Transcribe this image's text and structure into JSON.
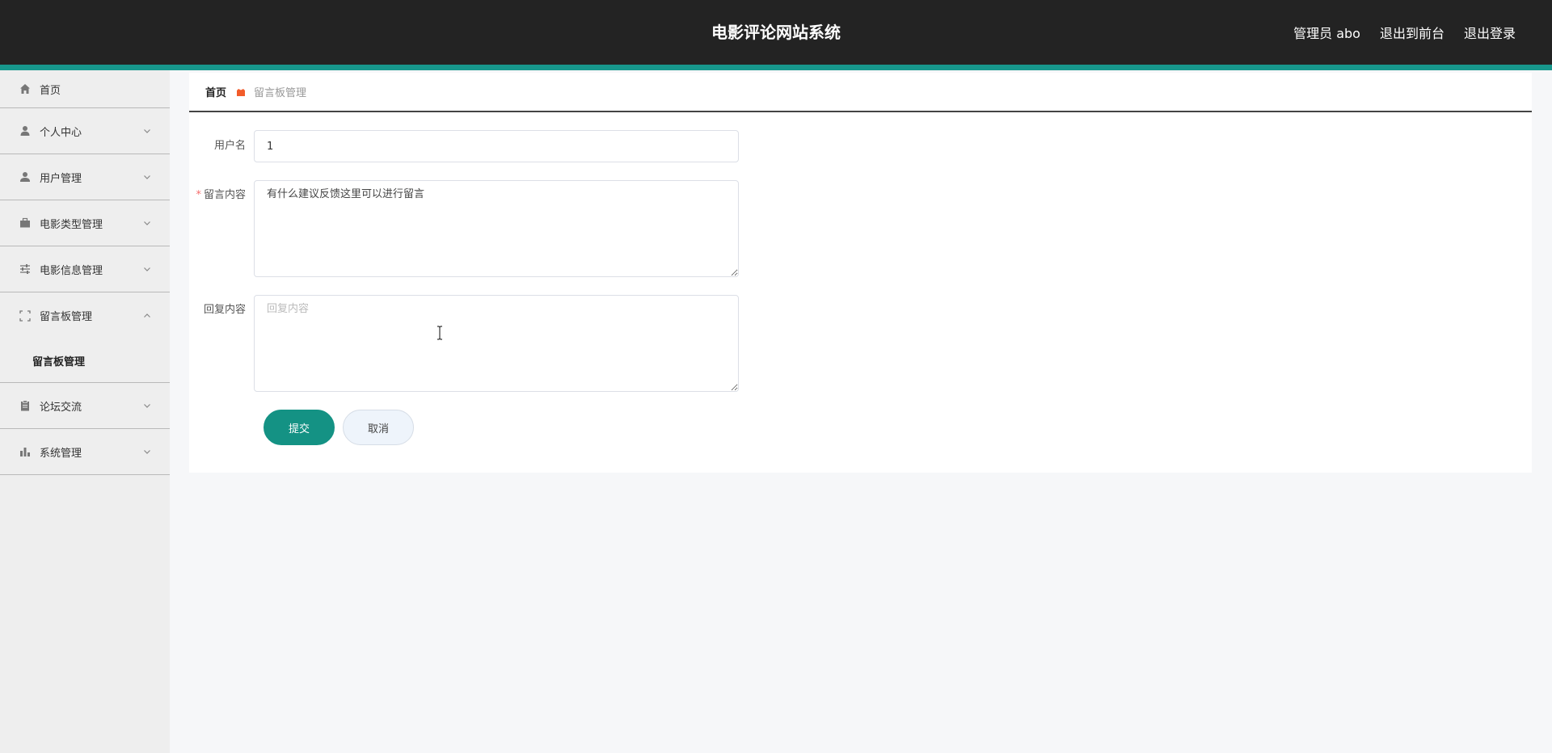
{
  "header": {
    "title": "电影评论网站系统",
    "admin_label": "管理员 abo",
    "to_front_label": "退出到前台",
    "logout_label": "退出登录"
  },
  "sidebar": {
    "items": [
      {
        "label": "首页",
        "icon": "home-icon"
      },
      {
        "label": "个人中心",
        "icon": "user-icon"
      },
      {
        "label": "用户管理",
        "icon": "user-manage-icon"
      },
      {
        "label": "电影类型管理",
        "icon": "briefcase-icon"
      },
      {
        "label": "电影信息管理",
        "icon": "sliders-icon"
      },
      {
        "label": "留言板管理",
        "icon": "frame-icon"
      },
      {
        "label": "论坛交流",
        "icon": "clipboard-icon"
      },
      {
        "label": "系统管理",
        "icon": "bar-chart-icon"
      }
    ],
    "submenu": {
      "label": "留言板管理"
    }
  },
  "breadcrumb": {
    "home": "首页",
    "current": "留言板管理"
  },
  "form": {
    "username_label": "用户名",
    "username_value": "1",
    "message_label": "留言内容",
    "message_required_mark": "*",
    "message_value": "有什么建议反馈这里可以进行留言",
    "reply_label": "回复内容",
    "reply_placeholder": "回复内容",
    "submit_label": "提交",
    "cancel_label": "取消"
  },
  "colors": {
    "topbar": "#232323",
    "accent": "#17978c",
    "submit": "#149284",
    "breadcrumb_sep": "#f25c2a",
    "required": "#f56c6c"
  }
}
